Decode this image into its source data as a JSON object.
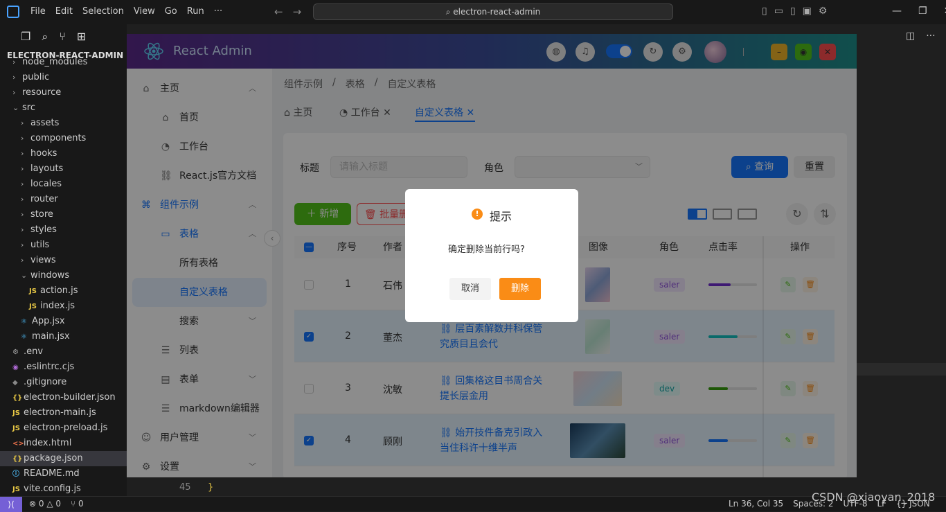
{
  "vscode": {
    "menu": [
      "File",
      "Edit",
      "Selection",
      "View",
      "Go",
      "Run",
      "···"
    ],
    "search": "electron-react-admin",
    "explorer_title": "ELECTRON-REACT-ADMIN",
    "tree": [
      {
        "label": "node_modules",
        "type": "folder",
        "indent": 1
      },
      {
        "label": "public",
        "type": "folder",
        "indent": 1
      },
      {
        "label": "resource",
        "type": "folder",
        "indent": 1
      },
      {
        "label": "src",
        "type": "folder-open",
        "indent": 1
      },
      {
        "label": "assets",
        "type": "folder",
        "indent": 2
      },
      {
        "label": "components",
        "type": "folder",
        "indent": 2
      },
      {
        "label": "hooks",
        "type": "folder",
        "indent": 2
      },
      {
        "label": "layouts",
        "type": "folder",
        "indent": 2
      },
      {
        "label": "locales",
        "type": "folder",
        "indent": 2
      },
      {
        "label": "router",
        "type": "folder",
        "indent": 2
      },
      {
        "label": "store",
        "type": "folder",
        "indent": 2
      },
      {
        "label": "styles",
        "type": "folder",
        "indent": 2
      },
      {
        "label": "utils",
        "type": "folder",
        "indent": 2
      },
      {
        "label": "views",
        "type": "folder",
        "indent": 2
      },
      {
        "label": "windows",
        "type": "folder-open",
        "indent": 2
      },
      {
        "label": "action.js",
        "type": "js",
        "indent": 3
      },
      {
        "label": "index.js",
        "type": "js",
        "indent": 3
      },
      {
        "label": "App.jsx",
        "type": "jsx",
        "indent": 2
      },
      {
        "label": "main.jsx",
        "type": "jsx",
        "indent": 2
      },
      {
        "label": ".env",
        "type": "env",
        "indent": 1
      },
      {
        "label": ".eslintrc.cjs",
        "type": "esl",
        "indent": 1
      },
      {
        "label": ".gitignore",
        "type": "git",
        "indent": 1
      },
      {
        "label": "electron-builder.json",
        "type": "json",
        "indent": 1
      },
      {
        "label": "electron-main.js",
        "type": "js",
        "indent": 1
      },
      {
        "label": "electron-preload.js",
        "type": "js",
        "indent": 1
      },
      {
        "label": "index.html",
        "type": "html5",
        "indent": 1
      },
      {
        "label": "package.json",
        "type": "json",
        "indent": 1,
        "selected": true
      },
      {
        "label": "README.md",
        "type": "md",
        "indent": 1
      },
      {
        "label": "vite.config.js",
        "type": "js",
        "indent": 1
      }
    ],
    "code_line_number": "45",
    "code_text": "}",
    "status_left": [
      "⊗ 0 △ 0",
      "⑂ 0"
    ],
    "status_right": [
      "Ln 36, Col 35",
      "Spaces: 2",
      "UTF-8",
      "LF",
      "{} JSON"
    ],
    "watermark": "CSDN @xiaoyan_2018"
  },
  "app": {
    "title": "React Admin",
    "menu": [
      {
        "label": "主页",
        "icon": "⌂",
        "arrow": "︿",
        "level": 0
      },
      {
        "label": "首页",
        "icon": "⌂",
        "level": 1
      },
      {
        "label": "工作台",
        "icon": "◔",
        "level": 1
      },
      {
        "label": "React.js官方文档",
        "icon": "⛓",
        "level": 1
      },
      {
        "label": "组件示例",
        "icon": "⌘",
        "arrow": "︿",
        "level": 0,
        "active": true
      },
      {
        "label": "表格",
        "icon": "▭",
        "arrow": "︿",
        "level": 1,
        "active": true
      },
      {
        "label": "所有表格",
        "level": 2
      },
      {
        "label": "自定义表格",
        "level": 2,
        "selected": true
      },
      {
        "label": "搜索",
        "arrow": "﹀",
        "level": 2
      },
      {
        "label": "列表",
        "icon": "☰",
        "level": 1
      },
      {
        "label": "表单",
        "icon": "▤",
        "arrow": "﹀",
        "level": 1
      },
      {
        "label": "markdown编辑器",
        "icon": "☰",
        "level": 1
      },
      {
        "label": "用户管理",
        "icon": "☺",
        "arrow": "﹀",
        "level": 0
      },
      {
        "label": "设置",
        "icon": "⚙",
        "arrow": "﹀",
        "level": 0
      }
    ],
    "breadcrumb": [
      "组件示例",
      "/",
      "表格",
      "/",
      "自定义表格"
    ],
    "tabs": [
      {
        "label": "⌂ 主页",
        "closable": false
      },
      {
        "label": "◔ 工作台",
        "closable": true
      },
      {
        "label": "自定义表格",
        "closable": true,
        "active": true
      }
    ],
    "filter": {
      "title_label": "标题",
      "title_placeholder": "请输入标题",
      "role_label": "角色",
      "query": "查询",
      "reset": "重置"
    },
    "toolbar": {
      "add": "新增",
      "batch_delete": "批量删除"
    },
    "columns": [
      "序号",
      "作者",
      "图像",
      "角色",
      "点击率",
      "操作"
    ],
    "rows": [
      {
        "no": "1",
        "author": "石伟",
        "title": "",
        "role": "saler",
        "rate": 0.45,
        "rate_color": "#722ed1",
        "checked": false
      },
      {
        "no": "2",
        "author": "董杰",
        "title": "层百素解数并科保管究质目且会代",
        "role": "saler",
        "rate": 0.6,
        "rate_color": "#13c2c2",
        "checked": true
      },
      {
        "no": "3",
        "author": "沈敏",
        "title": "回集格这目书周合关提长层金用",
        "role": "dev",
        "rate": 0.4,
        "rate_color": "#389e0d",
        "checked": false
      },
      {
        "no": "4",
        "author": "顾刚",
        "title": "始开技件备克引政入当住科许十维半声",
        "role": "saler",
        "rate": 0.4,
        "rate_color": "#1677ff",
        "checked": true
      }
    ],
    "modal": {
      "title": "提示",
      "body": "确定删除当前行吗?",
      "cancel": "取消",
      "ok": "删除"
    }
  }
}
